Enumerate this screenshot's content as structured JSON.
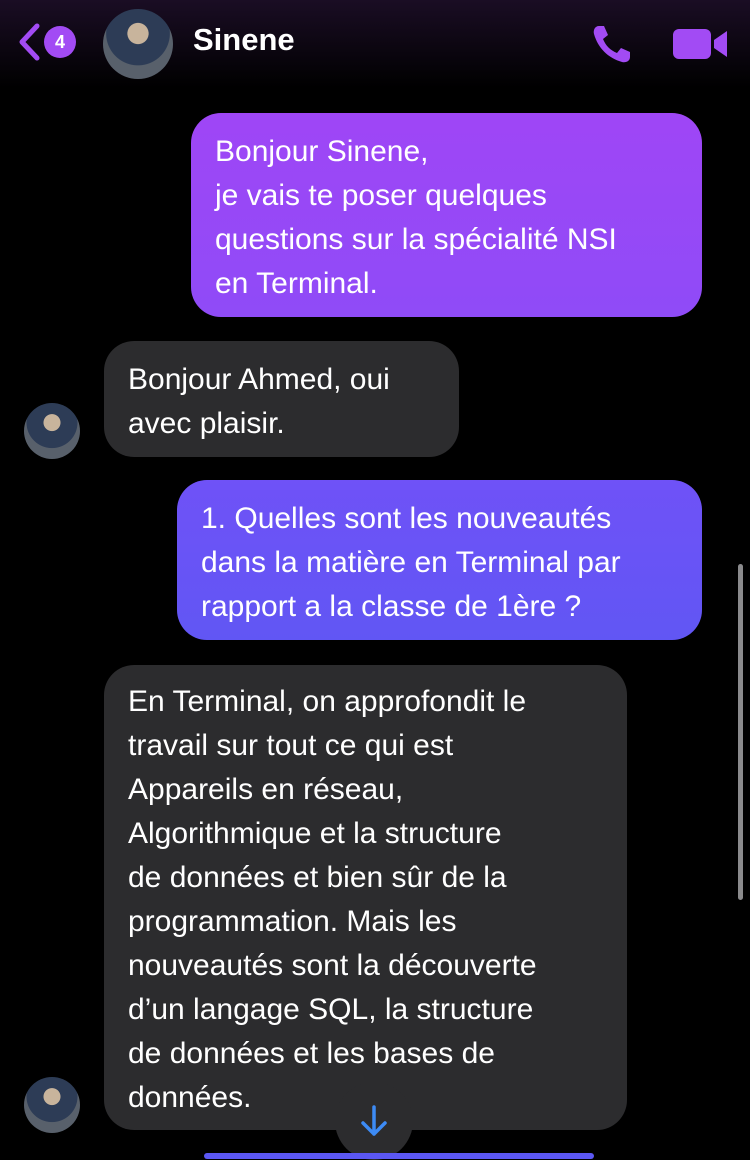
{
  "header": {
    "back_icon": "chevron-left-icon",
    "unread_count": "4",
    "contact_name": "Sinene",
    "call_icon": "phone-icon",
    "video_icon": "video-camera-icon"
  },
  "messages": [
    {
      "direction": "outgoing",
      "text": "Bonjour Sinene,\nje vais te poser quelques\nquestions sur la spécialité NSI\nen Terminal."
    },
    {
      "direction": "incoming",
      "text": "Bonjour Ahmed, oui\navec plaisir."
    },
    {
      "direction": "outgoing",
      "text": "1. Quelles sont les nouveautés\ndans la matière en Terminal par\nrapport a la classe de 1ère ?"
    },
    {
      "direction": "incoming",
      "text": "En Terminal, on approfondit le\ntravail sur tout ce qui est\nAppareils en réseau,\nAlgorithmique et la structure\nde données et bien sûr de la\nprogrammation. Mais les\nnouveautés sont la découverte\nd’un langage SQL, la structure\nde données et les bases de\ndonnées."
    }
  ],
  "scroll_down_icon": "arrow-down-icon",
  "colors": {
    "accent": "#a24bf4",
    "outgoing_purple": "#9b47f6",
    "outgoing_blue": "#6654f5",
    "incoming": "#2c2c2e"
  }
}
